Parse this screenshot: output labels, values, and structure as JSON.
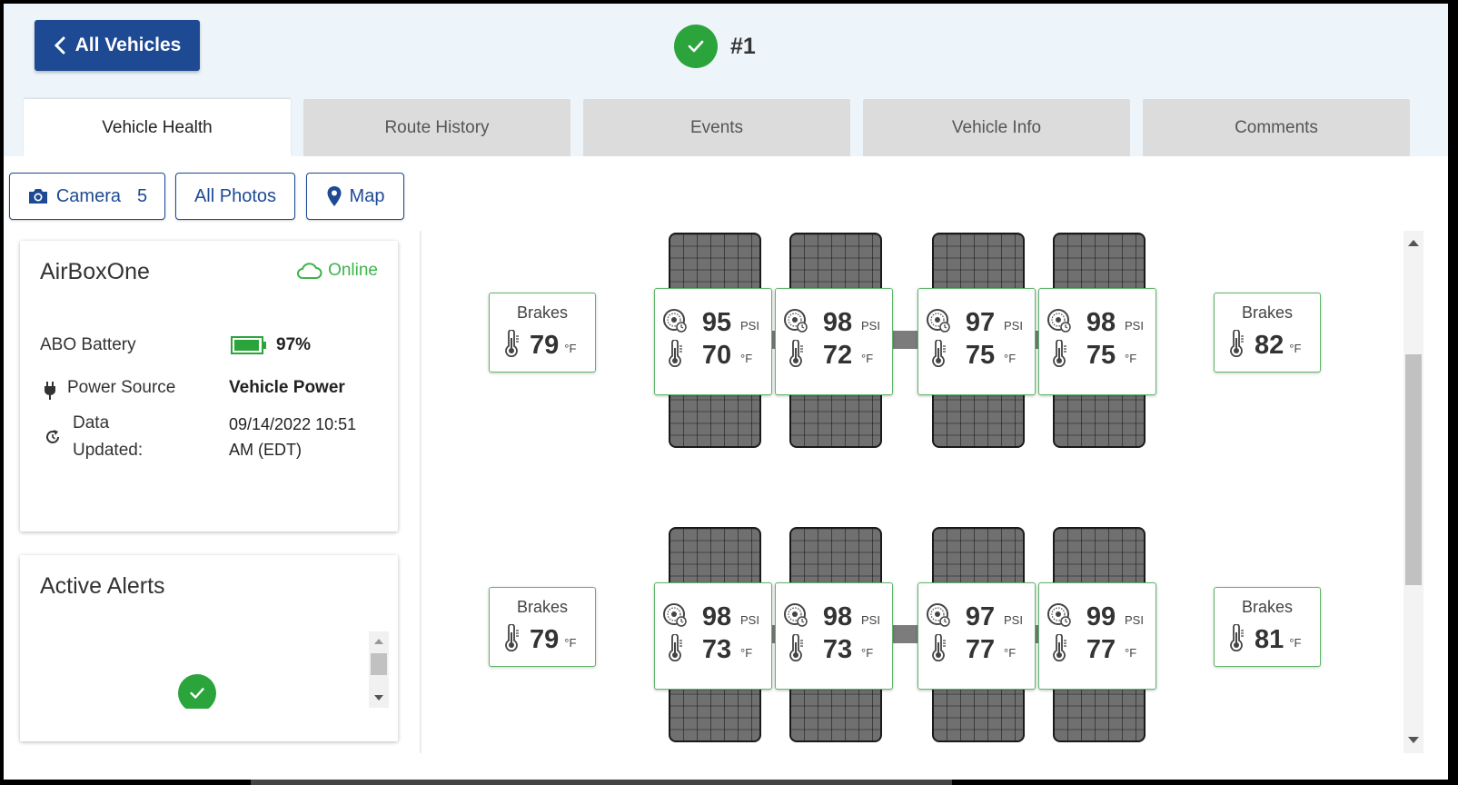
{
  "header": {
    "back_label": "All Vehicles",
    "vehicle_id": "#1"
  },
  "tabs": [
    {
      "label": "Vehicle Health",
      "active": true
    },
    {
      "label": "Route History",
      "active": false
    },
    {
      "label": "Events",
      "active": false
    },
    {
      "label": "Vehicle Info",
      "active": false
    },
    {
      "label": "Comments",
      "active": false
    }
  ],
  "toolbar": {
    "camera_label": "Camera",
    "camera_count": "5",
    "photos_label": "All Photos",
    "map_label": "Map"
  },
  "device": {
    "name": "AirBoxOne",
    "status": "Online",
    "battery_label": "ABO Battery",
    "battery_value": "97%",
    "battery_level": 0.97,
    "power_label": "Power Source",
    "power_value": "Vehicle Power",
    "updated_label_1": "Data",
    "updated_label_2": "Updated:",
    "updated_value_1": "09/14/2022 10:51",
    "updated_value_2": "AM (EDT)"
  },
  "alerts": {
    "title": "Active Alerts"
  },
  "units": {
    "pressure": "PSI",
    "temperature": "°F"
  },
  "brakes_label": "Brakes",
  "axles": [
    {
      "brake_left": "79",
      "brake_right": "82",
      "tires": [
        {
          "psi": "95",
          "temp": "70"
        },
        {
          "psi": "98",
          "temp": "72"
        },
        {
          "psi": "97",
          "temp": "75"
        },
        {
          "psi": "98",
          "temp": "75"
        }
      ]
    },
    {
      "brake_left": "79",
      "brake_right": "81",
      "tires": [
        {
          "psi": "98",
          "temp": "73"
        },
        {
          "psi": "98",
          "temp": "73"
        },
        {
          "psi": "97",
          "temp": "77"
        },
        {
          "psi": "99",
          "temp": "77"
        }
      ]
    }
  ],
  "colors": {
    "primary": "#1d4a93",
    "ok_green": "#2ba43b",
    "online_green": "#3cb44b",
    "tire_border": "#5fb56a"
  }
}
